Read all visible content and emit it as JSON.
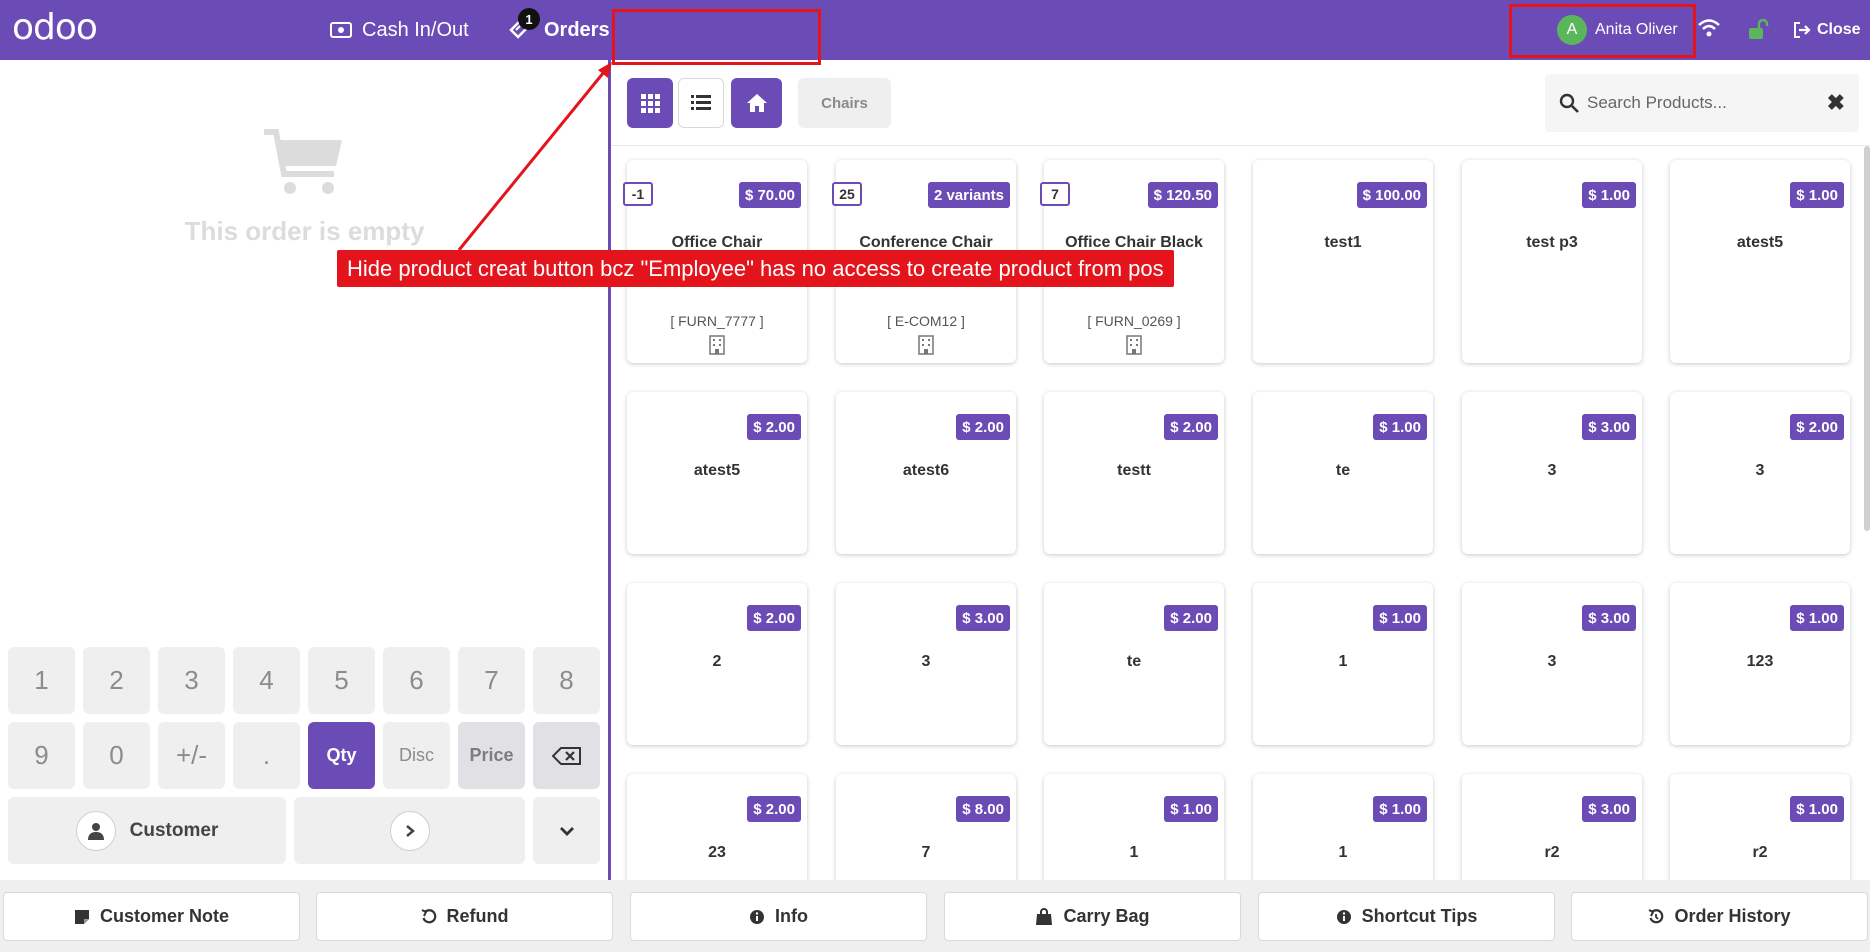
{
  "topbar": {
    "logo": "odoo",
    "cash_label": "Cash In/Out",
    "orders_label": "Orders",
    "orders_count": "1",
    "user_initial": "A",
    "user_name": "Anita Oliver",
    "close_label": "Close"
  },
  "order": {
    "empty_text": "This order is empty"
  },
  "numpad": {
    "keys_row1": [
      "1",
      "2",
      "3",
      "4",
      "5",
      "6",
      "7",
      "8"
    ],
    "keys_row2": [
      "9",
      "0",
      "+/-",
      "."
    ],
    "qty": "Qty",
    "disc": "Disc",
    "price": "Price",
    "customer": "Customer"
  },
  "products_bar": {
    "category": "Chairs",
    "search_placeholder": "Search Products..."
  },
  "products": [
    {
      "name": "Office Chair",
      "price": "$ 70.00",
      "qty": "-1",
      "ref": "[ FURN_7777 ]"
    },
    {
      "name": "Conference Chair",
      "price": "2 variants",
      "qty": "25",
      "ref": "[ E-COM12 ]"
    },
    {
      "name": "Office Chair Black",
      "price": "$ 120.50",
      "qty": "7",
      "ref": "[ FURN_0269 ]"
    },
    {
      "name": "test1",
      "price": "$ 100.00"
    },
    {
      "name": "test p3",
      "price": "$ 1.00"
    },
    {
      "name": "atest5",
      "price": "$ 1.00"
    },
    {
      "name": "atest5",
      "price": "$ 2.00"
    },
    {
      "name": "atest6",
      "price": "$ 2.00"
    },
    {
      "name": "testt",
      "price": "$ 2.00"
    },
    {
      "name": "te",
      "price": "$ 1.00"
    },
    {
      "name": "3",
      "price": "$ 3.00"
    },
    {
      "name": "3",
      "price": "$ 2.00"
    },
    {
      "name": "2",
      "price": "$ 2.00"
    },
    {
      "name": "3",
      "price": "$ 3.00"
    },
    {
      "name": "te",
      "price": "$ 2.00"
    },
    {
      "name": "1",
      "price": "$ 1.00"
    },
    {
      "name": "3",
      "price": "$ 3.00"
    },
    {
      "name": "123",
      "price": "$ 1.00"
    },
    {
      "name": "23",
      "price": "$ 2.00"
    },
    {
      "name": "7",
      "price": "$ 8.00"
    },
    {
      "name": "1",
      "price": "$ 1.00"
    },
    {
      "name": "1",
      "price": "$ 1.00"
    },
    {
      "name": "r2",
      "price": "$ 3.00"
    },
    {
      "name": "r2",
      "price": "$ 1.00"
    }
  ],
  "bottom": {
    "customer_note": "Customer Note",
    "refund": "Refund",
    "info": "Info",
    "carry_bag": "Carry Bag",
    "shortcut_tips": "Shortcut Tips",
    "order_history": "Order History"
  },
  "annotation": {
    "text": "Hide product creat button bcz \"Employee\" has no access to create product from pos"
  },
  "colors": {
    "brand": "#6b4bb6",
    "annotation": "#e3141c"
  }
}
